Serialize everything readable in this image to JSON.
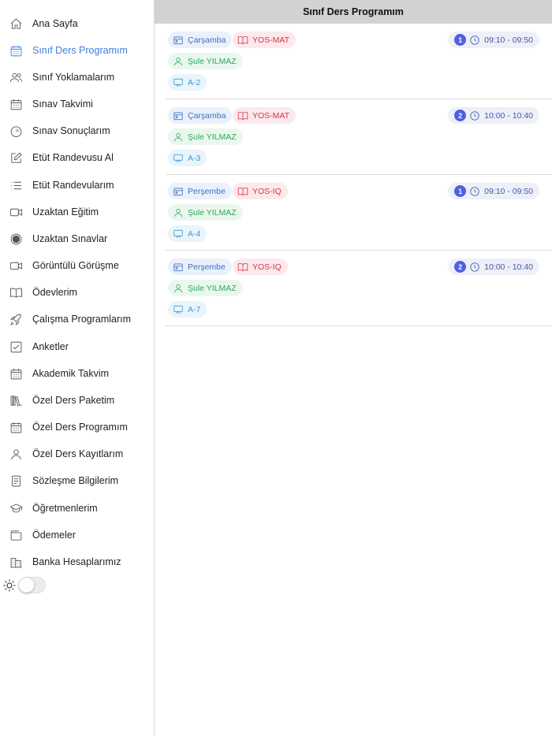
{
  "header": {
    "title": "Sınıf Ders Programım"
  },
  "sidebar": {
    "items": [
      {
        "label": "Ana Sayfa",
        "icon": "home-icon"
      },
      {
        "label": "Sınıf Ders Programım",
        "icon": "calendar-icon",
        "active": true
      },
      {
        "label": "Sınıf Yoklamalarım",
        "icon": "users-icon"
      },
      {
        "label": "Sınav Takvimi",
        "icon": "calendar-icon"
      },
      {
        "label": "Sınav Sonuçlarım",
        "icon": "gauge-icon"
      },
      {
        "label": "Etüt Randevusu Al",
        "icon": "edit-icon"
      },
      {
        "label": "Etüt Randevularım",
        "icon": "list-icon"
      },
      {
        "label": "Uzaktan Eğitim",
        "icon": "video-icon"
      },
      {
        "label": "Uzaktan Sınavlar",
        "icon": "record-icon"
      },
      {
        "label": "Görüntülü Görüşme",
        "icon": "video-icon"
      },
      {
        "label": "Ödevlerim",
        "icon": "book-icon"
      },
      {
        "label": "Çalışma Programlarım",
        "icon": "rocket-icon"
      },
      {
        "label": "Anketler",
        "icon": "checkbox-icon"
      },
      {
        "label": "Akademik Takvim",
        "icon": "calendar-icon"
      },
      {
        "label": "Özel Ders Paketim",
        "icon": "books-icon"
      },
      {
        "label": "Özel Ders Programım",
        "icon": "calendar-icon"
      },
      {
        "label": "Özel Ders Kayıtlarım",
        "icon": "user-icon"
      },
      {
        "label": "Sözleşme Bilgilerim",
        "icon": "document-icon"
      },
      {
        "label": "Öğretmenlerim",
        "icon": "graduation-cap-icon"
      },
      {
        "label": "Ödemeler",
        "icon": "wallet-icon"
      },
      {
        "label": "Banka Hesaplarımız",
        "icon": "building-icon"
      }
    ],
    "theme_toggle": {
      "icon": "sun-icon",
      "on": false
    }
  },
  "schedule": [
    {
      "day": "Çarşamba",
      "lesson": "YOS-MAT",
      "teacher": "Şule YILMAZ",
      "room": "A-2",
      "order": "1",
      "time": "09:10 - 09:50"
    },
    {
      "day": "Çarşamba",
      "lesson": "YOS-MAT",
      "teacher": "Şule YILMAZ",
      "room": "A-3",
      "order": "2",
      "time": "10:00 - 10:40"
    },
    {
      "day": "Perşembe",
      "lesson": "YOS-IQ",
      "teacher": "Şule YILMAZ",
      "room": "A-4",
      "order": "1",
      "time": "09:10 - 09:50"
    },
    {
      "day": "Perşembe",
      "lesson": "YOS-IQ",
      "teacher": "Şule YILMAZ",
      "room": "A-7",
      "order": "2",
      "time": "10:00 - 10:40"
    }
  ],
  "colors": {
    "accent": "#3f7fdc",
    "header_bg": "#d2d2d2",
    "day": "#3f6fc0",
    "lesson": "#d6334d",
    "teacher": "#2fa85a",
    "room": "#3a9bd5",
    "order_badge": "#4f5fe0"
  }
}
